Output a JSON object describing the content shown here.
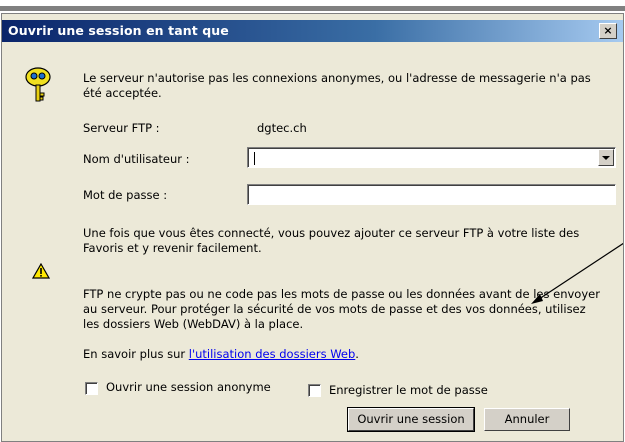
{
  "dialog": {
    "title": "Ouvrir une session en tant que",
    "close_label": "×"
  },
  "intro_text": "Le serveur n'autorise pas les connexions anonymes, ou l'adresse de messagerie n'a pas été acceptée.",
  "form": {
    "server_label": "Serveur FTP :",
    "server_value": "dgtec.ch",
    "username_label": "Nom d'utilisateur :",
    "username_value": "",
    "password_label": "Mot de passe :",
    "password_value": ""
  },
  "info_text": "Une fois que vous êtes connecté, vous pouvez ajouter ce serveur FTP à votre liste des Favoris et y revenir facilement.",
  "warning_text": "FTP ne crypte pas ou ne code pas les mots de passe ou les données avant de les envoyer au serveur. Pour protéger la sécurité de vos mots de passe et des vos données, utilisez les dossiers Web (WebDAV) à la place.",
  "learn_more": {
    "prefix": "En savoir plus sur ",
    "link_text": "l'utilisation des dossiers Web",
    "suffix": "."
  },
  "options": {
    "anonymous_label": "Ouvrir une session anonyme",
    "anonymous_checked": false,
    "save_password_label": "Enregistrer le mot de passe",
    "save_password_checked": false
  },
  "buttons": {
    "login_label": "Ouvrir une session",
    "cancel_label": "Annuler"
  },
  "icons": {
    "keys": "keys-icon",
    "warning": "warning-icon"
  }
}
